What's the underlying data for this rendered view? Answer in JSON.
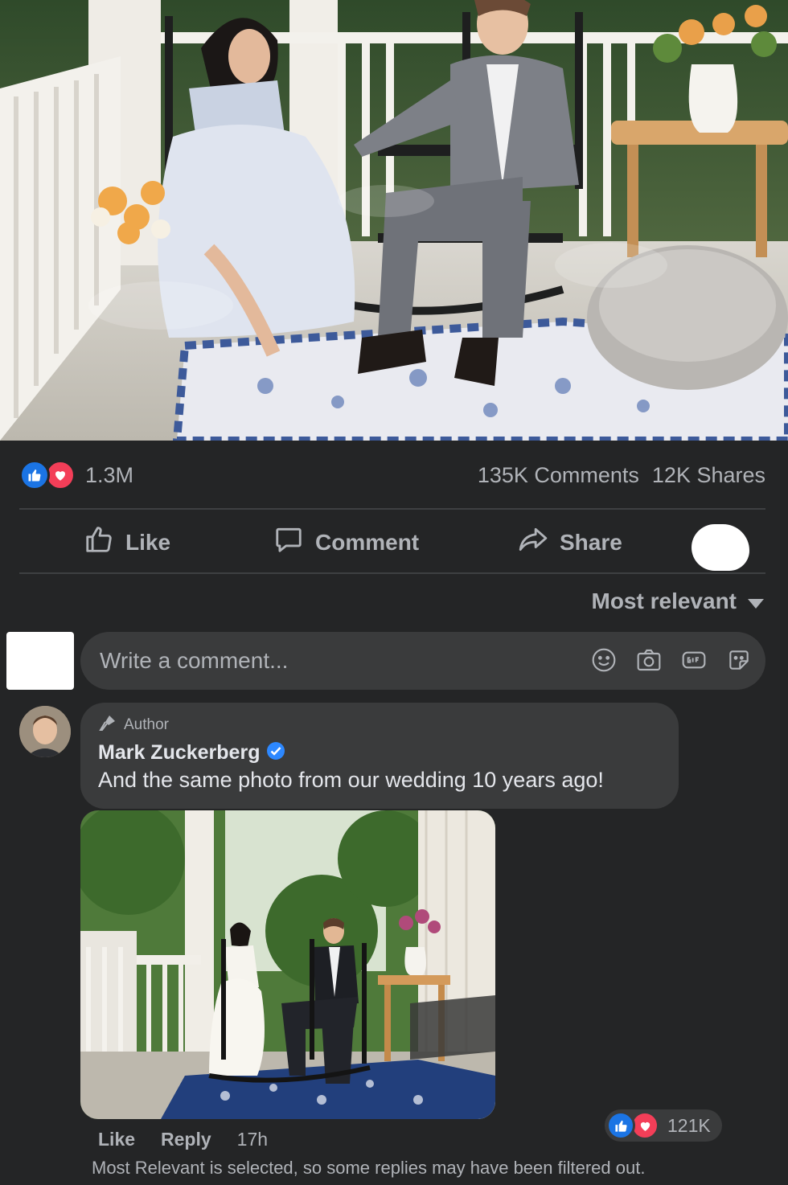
{
  "post": {
    "reaction_count": "1.3M",
    "comments": "135K Comments",
    "shares": "12K Shares"
  },
  "actions": {
    "like": "Like",
    "comment": "Comment",
    "share": "Share"
  },
  "sort": {
    "label": "Most relevant"
  },
  "composer": {
    "placeholder": "Write a comment..."
  },
  "comment": {
    "badge": "Author",
    "author": "Mark Zuckerberg",
    "text": "And the same photo from our wedding 10 years ago!",
    "like_label": "Like",
    "reply_label": "Reply",
    "time": "17h",
    "reaction_count": "121K"
  },
  "notice": "Most Relevant is selected, so some replies may have been filtered out.",
  "colors": {
    "background": "#242526",
    "surface": "#3a3b3c",
    "like_blue": "#1b74e4",
    "love_red": "#f33e58",
    "verified_blue": "#2d88ff"
  }
}
